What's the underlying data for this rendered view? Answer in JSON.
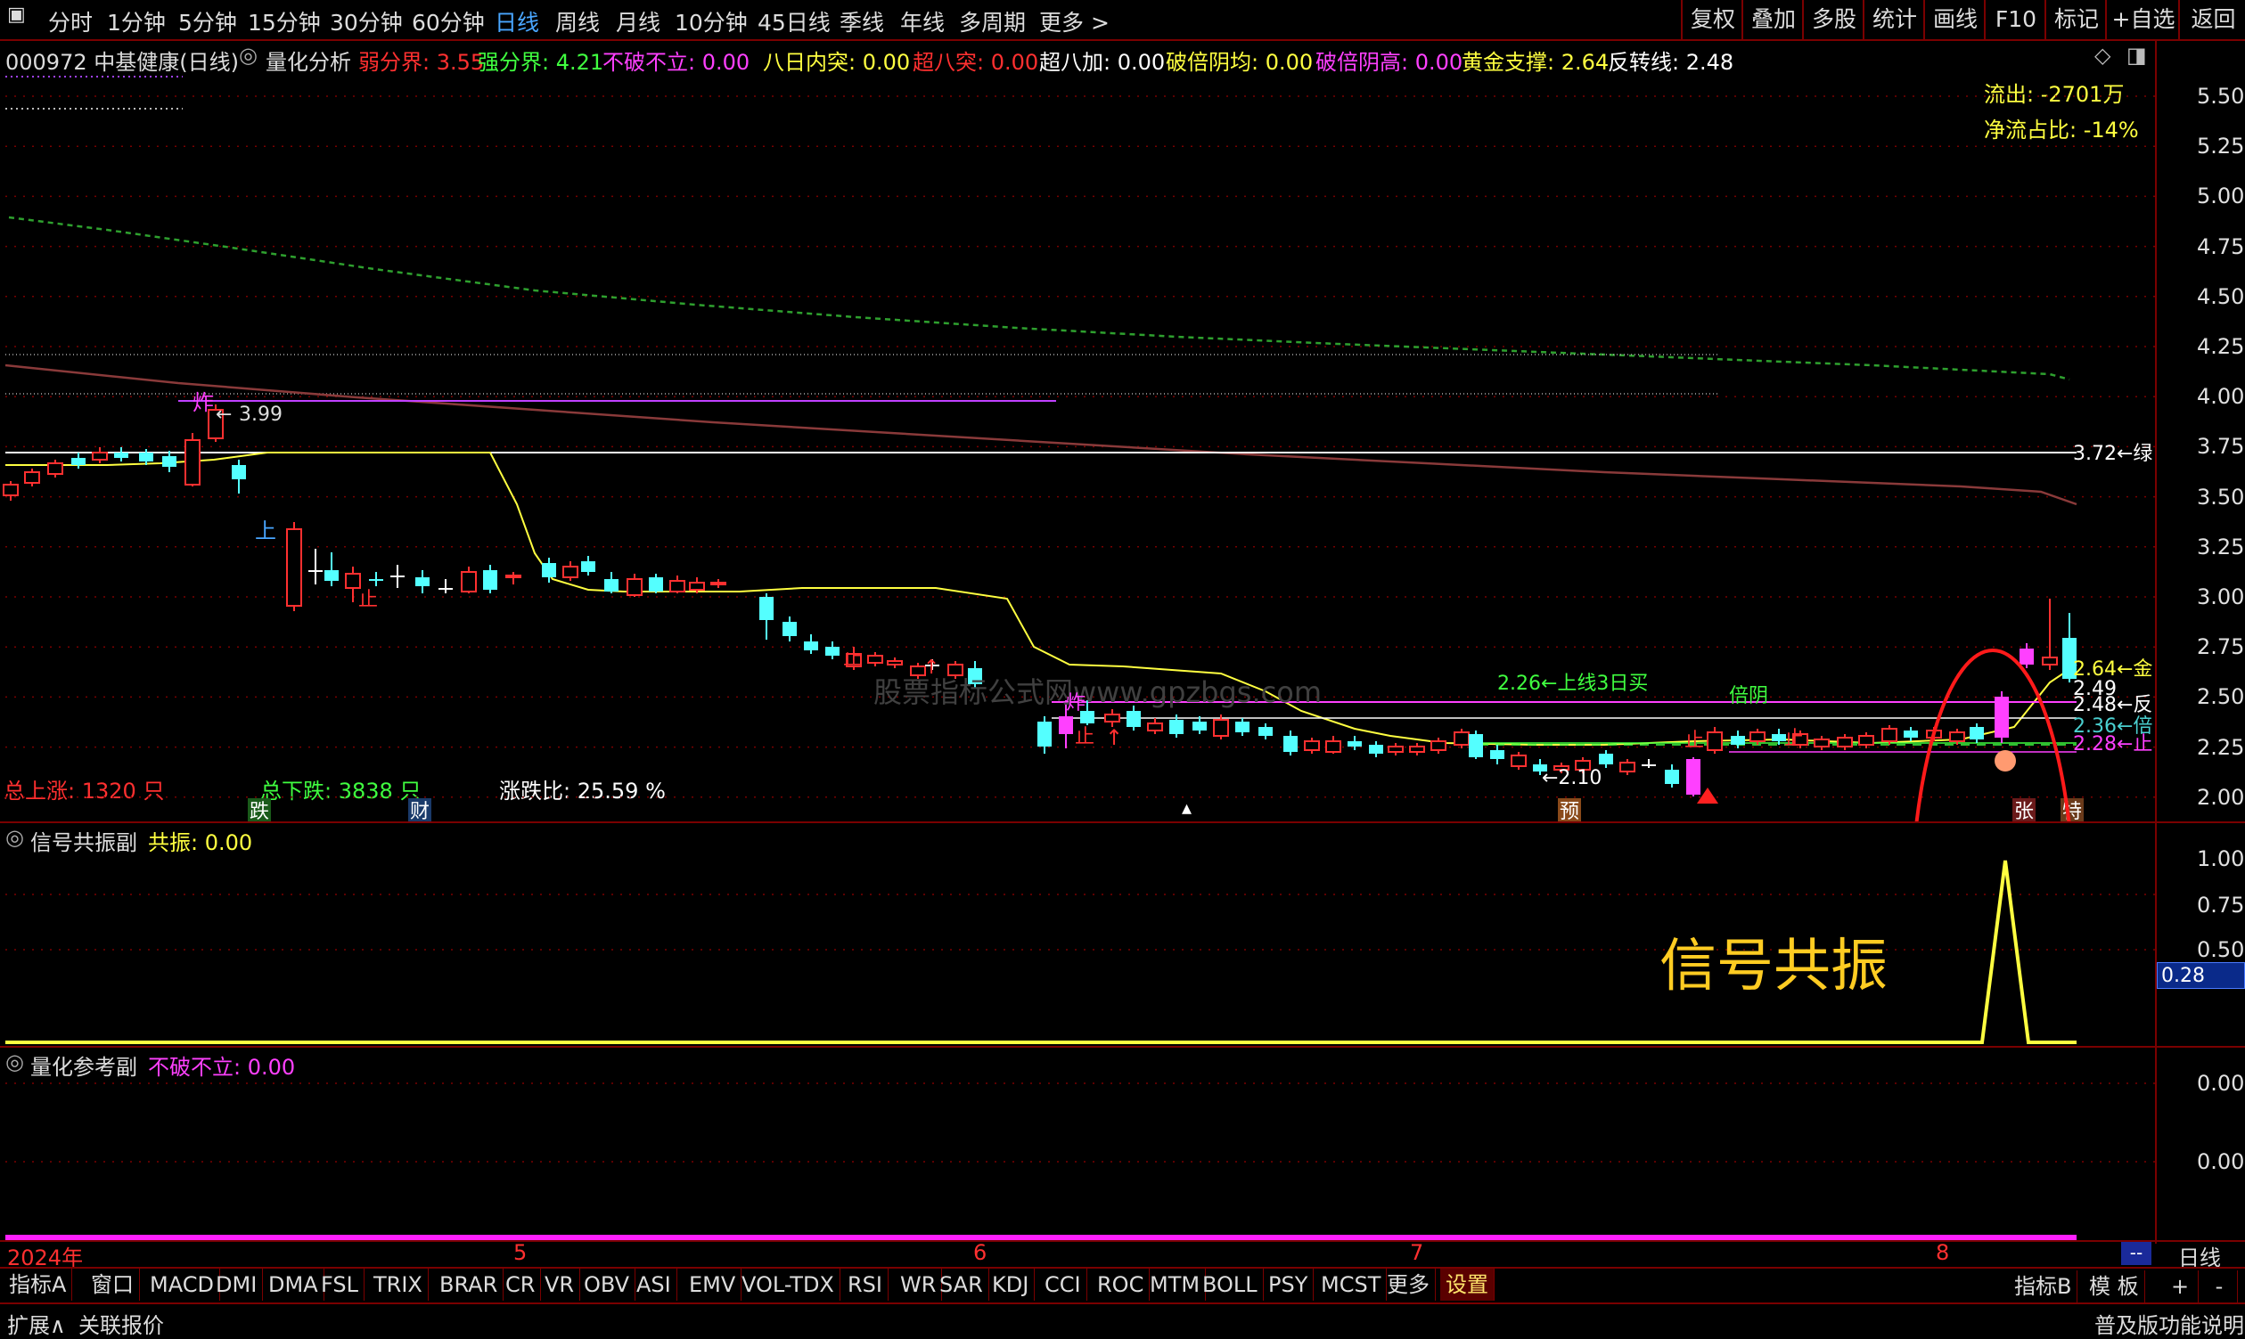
{
  "menu": {
    "periods": [
      "分时",
      "1分钟",
      "5分钟",
      "15分钟",
      "30分钟",
      "60分钟",
      "日线",
      "周线",
      "月线",
      "10分钟",
      "45日线",
      "季线",
      "年线",
      "多周期",
      "更多 >"
    ],
    "active_period": "日线",
    "right_buttons": [
      "复权",
      "叠加",
      "多股",
      "统计",
      "画线",
      "F10",
      "标记",
      "+自选",
      "返回"
    ]
  },
  "main_panel": {
    "symbol": "000972 中基健康(日线)",
    "indicator_name": "量化分析",
    "indicators": [
      {
        "label": "弱分界:",
        "value": "3.55",
        "color": "#ff3030"
      },
      {
        "label": "强分界:",
        "value": "4.21",
        "color": "#40ff40"
      },
      {
        "label": "不破不立:",
        "value": "0.00",
        "color": "#ff40ff"
      },
      {
        "label": "八日内突:",
        "value": "0.00",
        "color": "#ffff40"
      },
      {
        "label": "超八突:",
        "value": "0.00",
        "color": "#ff3030"
      },
      {
        "label": "超八加:",
        "value": "0.00",
        "color": "#ffffff"
      },
      {
        "label": "破倍阴均:",
        "value": "0.00",
        "color": "#ffff40"
      },
      {
        "label": "破倍阴高:",
        "value": "0.00",
        "color": "#ff40ff"
      },
      {
        "label": "黄金支撑:",
        "value": "2.64",
        "color": "#ffff40"
      },
      {
        "label": "反转线:",
        "value": "2.48",
        "color": "#ffffff"
      }
    ],
    "y_ticks": [
      "5.50",
      "5.25",
      "5.00",
      "4.75",
      "4.50",
      "4.25",
      "4.00",
      "3.75",
      "3.50",
      "3.25",
      "3.00",
      "2.75",
      "2.50",
      "2.25",
      "2.00"
    ],
    "y_range": [
      1.97,
      5.57
    ],
    "flow_out": "流出: -2701万",
    "net_flow_ratio": "净流占比: -14%",
    "stats": {
      "up_label": "总上涨:",
      "up_value": "1320 只",
      "down_label": "总下跌:",
      "down_value": "3838 只",
      "ratio_label": "涨跌比:",
      "ratio_value": "25.59 %"
    },
    "annotations": {
      "peak": "3.99",
      "zha": "炸",
      "level_372": "3.72←绿",
      "low": "←2.10",
      "buy3": "2.26←上线3日买",
      "beiyin": "倍阴",
      "r264": "2.64←金",
      "r249": "2.49",
      "r248": "2.48←反",
      "r236": "2.36←倍",
      "r228": "2.28←止",
      "zhi": "止",
      "shang": "上",
      "die": "跌",
      "cai": "财",
      "yu": "预",
      "zhang": "张",
      "te": "特",
      "watermark": "股票指标公式网www.gpzbgs.com"
    }
  },
  "sub1": {
    "name": "信号共振副",
    "label": "共振:",
    "value": "0.00",
    "y_ticks": [
      "1.00",
      "0.75",
      "0.50"
    ],
    "current": "0.28",
    "callout": "信号共振"
  },
  "sub2": {
    "name": "量化参考副",
    "label": "不破不立:",
    "value": "0.00",
    "y_ticks": [
      "0.00",
      "0.00"
    ]
  },
  "date_axis": {
    "year": "2024年",
    "months": [
      "5",
      "6",
      "7",
      "8"
    ]
  },
  "date_axis_right": {
    "button": "日线",
    "more": "--"
  },
  "indicator_tabs": [
    "指标A",
    "窗口",
    "MACD",
    "DMI",
    "DMA",
    "FSL",
    "TRIX",
    "BRAR",
    "CR",
    "VR",
    "OBV",
    "ASI",
    "EMV",
    "VOL-TDX",
    "RSI",
    "WR",
    "SAR",
    "KDJ",
    "CCI",
    "ROC",
    "MTM",
    "BOLL",
    "PSY",
    "MCST",
    "更多",
    "设置"
  ],
  "active_tab": "设置",
  "tab_right": [
    "指标B",
    "模 板",
    "+",
    "-"
  ],
  "status": {
    "left1": "扩展∧",
    "left2": "关联报价",
    "right": "普及版功能说明"
  },
  "colors": {
    "up": "#ff3030",
    "down": "#54ffff",
    "bg": "#000000",
    "grid": "#7a0000",
    "ma_yellow": "#ffff40",
    "ma_green": "#2ea02e",
    "ma_brown": "#8a3a3a",
    "magenta": "#ff40ff"
  }
}
